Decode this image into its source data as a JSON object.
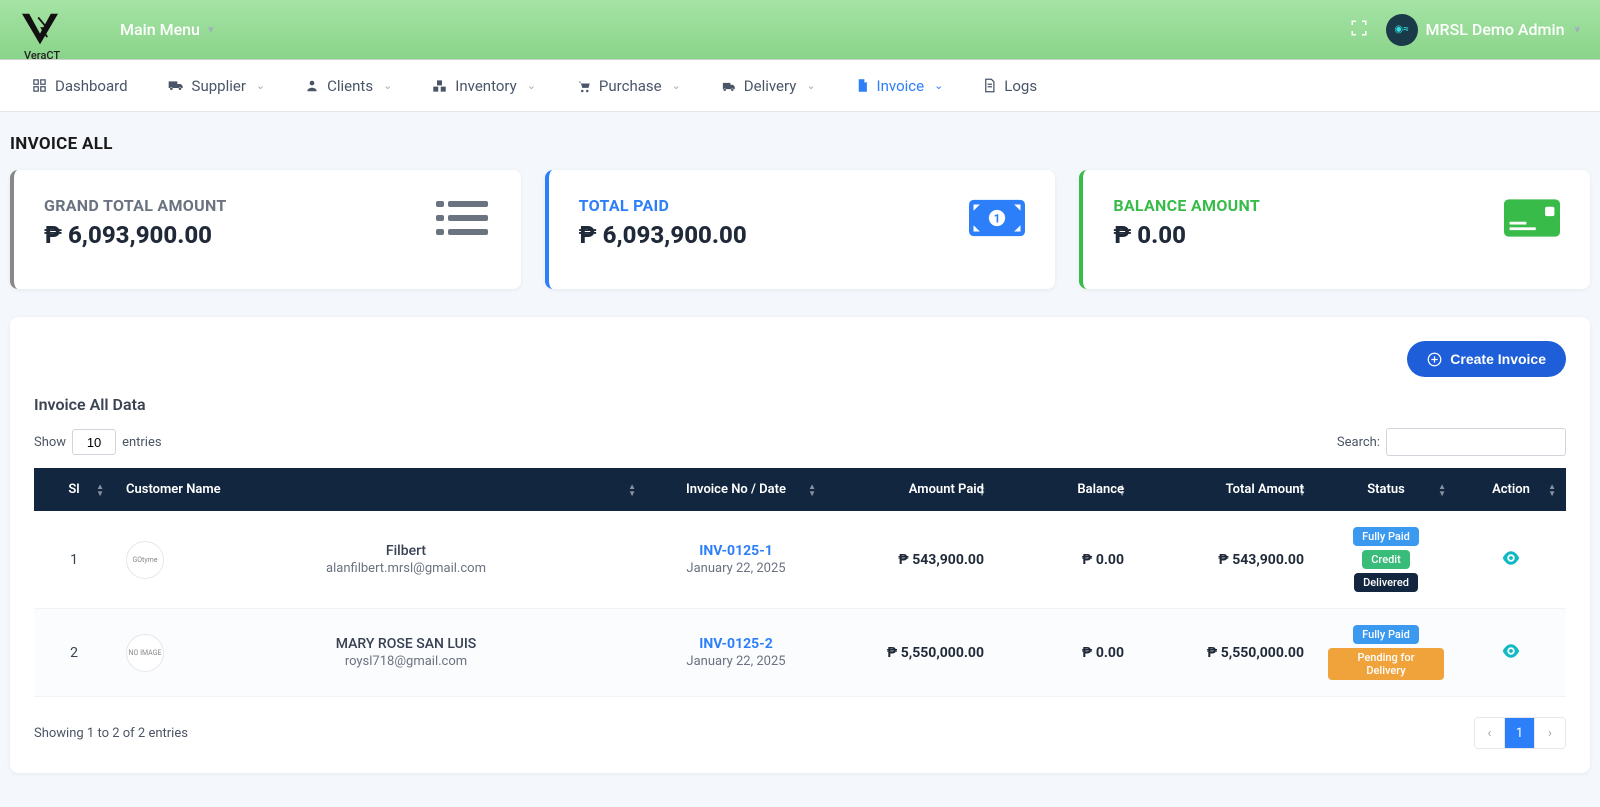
{
  "header": {
    "brand": "VeraCT",
    "mainMenu": "Main Menu",
    "userName": "MRSL Demo Admin"
  },
  "nav": {
    "dashboard": "Dashboard",
    "supplier": "Supplier",
    "clients": "Clients",
    "inventory": "Inventory",
    "purchase": "Purchase",
    "delivery": "Delivery",
    "invoice": "Invoice",
    "logs": "Logs"
  },
  "page": {
    "title": "INVOICE ALL",
    "dataTitle": "Invoice All Data",
    "createBtn": "Create Invoice"
  },
  "stats": {
    "grandTotal": {
      "label": "GRAND TOTAL AMOUNT",
      "value": "₱ 6,093,900.00"
    },
    "totalPaid": {
      "label": "TOTAL PAID",
      "value": "₱ 6,093,900.00"
    },
    "balance": {
      "label": "BALANCE AMOUNT",
      "value": "₱ 0.00"
    }
  },
  "tableControls": {
    "showLabel": "Show",
    "entriesLabel": "entries",
    "entriesValue": "10",
    "searchLabel": "Search:"
  },
  "columns": {
    "sl": "Sl",
    "customer": "Customer Name",
    "invoice": "Invoice No / Date",
    "paid": "Amount Paid",
    "balance": "Balance",
    "total": "Total Amount",
    "status": "Status",
    "action": "Action"
  },
  "rows": [
    {
      "sl": "1",
      "avatarLabel": "GOtyme",
      "name": "Filbert",
      "email": "alanfilbert.mrsl@gmail.com",
      "invNo": "INV-0125-1",
      "invDate": "January 22, 2025",
      "paid": "₱ 543,900.00",
      "balance": "₱ 0.00",
      "total": "₱ 543,900.00",
      "badges": [
        {
          "text": "Fully Paid",
          "cls": "blue"
        },
        {
          "text": "Credit",
          "cls": "green"
        },
        {
          "text": "Delivered",
          "cls": "dark"
        }
      ]
    },
    {
      "sl": "2",
      "avatarLabel": "NO IMAGE",
      "name": "MARY ROSE SAN LUIS",
      "email": "roysl718@gmail.com",
      "invNo": "INV-0125-2",
      "invDate": "January 22, 2025",
      "paid": "₱ 5,550,000.00",
      "balance": "₱ 0.00",
      "total": "₱ 5,550,000.00",
      "badges": [
        {
          "text": "Fully Paid",
          "cls": "blue"
        },
        {
          "text": "Pending for Delivery",
          "cls": "orange"
        }
      ]
    }
  ],
  "footer": {
    "info": "Showing 1 to 2 of 2 entries",
    "page": "1"
  }
}
